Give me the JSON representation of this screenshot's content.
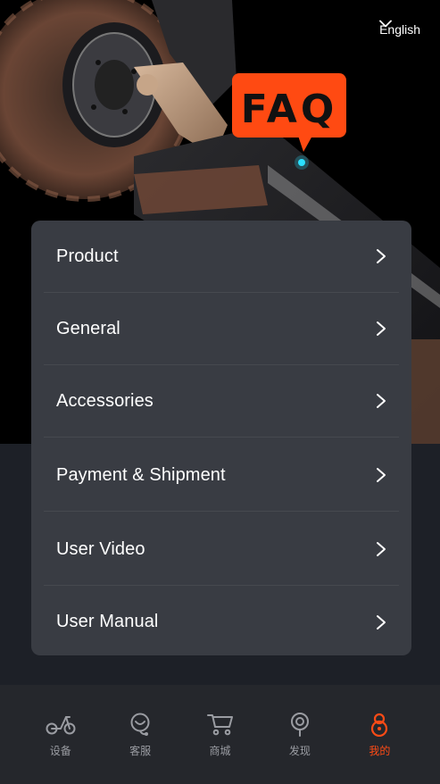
{
  "header": {
    "language": "English"
  },
  "banner": {
    "badge_text": "FAQ",
    "accent_color": "#ff4a12"
  },
  "faq": {
    "items": [
      {
        "label": "Product"
      },
      {
        "label": "General"
      },
      {
        "label": "Accessories"
      },
      {
        "label": "Payment & Shipment"
      },
      {
        "label": "User Video"
      },
      {
        "label": "User Manual"
      }
    ]
  },
  "tabbar": {
    "tabs": [
      {
        "label": "设备",
        "icon": "scooter-icon",
        "active": false
      },
      {
        "label": "客服",
        "icon": "support-icon",
        "active": false
      },
      {
        "label": "商城",
        "icon": "cart-icon",
        "active": false
      },
      {
        "label": "发现",
        "icon": "discover-icon",
        "active": false
      },
      {
        "label": "我的",
        "icon": "profile-icon",
        "active": true
      }
    ],
    "active_color": "#ff4b16",
    "inactive_color": "#9a9ca2"
  }
}
